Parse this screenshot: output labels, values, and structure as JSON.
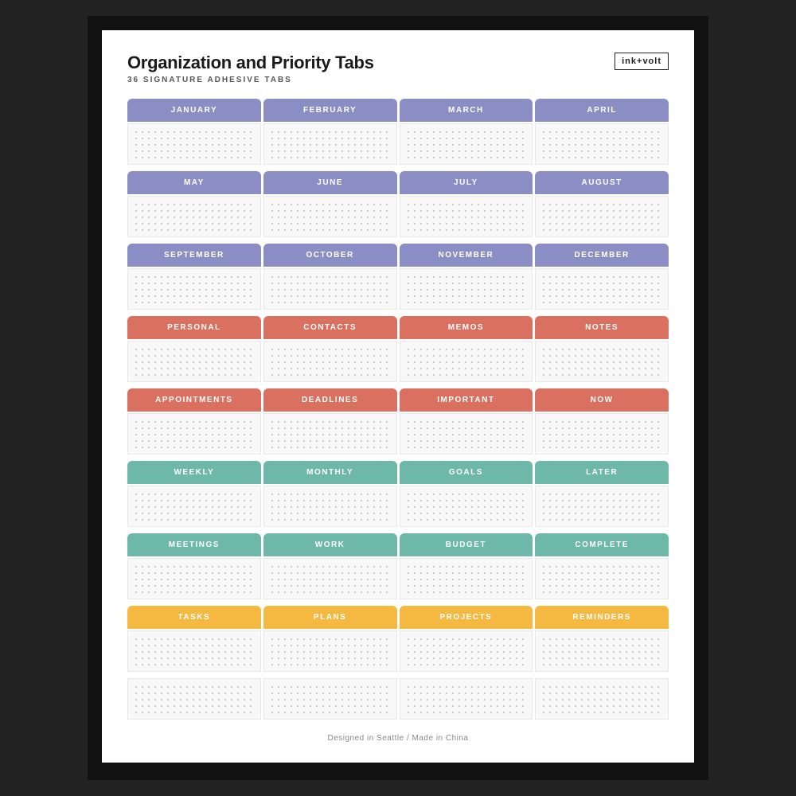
{
  "header": {
    "title": "Organization and Priority Tabs",
    "subtitle": "36 SIGNATURE ADHESIVE TABS",
    "brand": "ink+volt"
  },
  "rows": [
    {
      "color": "purple",
      "tabs": [
        "JANUARY",
        "FEBRUARY",
        "MARCH",
        "APRIL"
      ]
    },
    {
      "color": "purple",
      "tabs": [
        "MAY",
        "JUNE",
        "JULY",
        "AUGUST"
      ]
    },
    {
      "color": "purple",
      "tabs": [
        "SEPTEMBER",
        "OCTOBER",
        "NOVEMBER",
        "DECEMBER"
      ]
    },
    {
      "color": "salmon",
      "tabs": [
        "PERSONAL",
        "CONTACTS",
        "MEMOS",
        "NOTES"
      ]
    },
    {
      "color": "salmon",
      "tabs": [
        "APPOINTMENTS",
        "DEADLINES",
        "IMPORTANT",
        "NOW"
      ]
    },
    {
      "color": "teal",
      "tabs": [
        "WEEKLY",
        "MONTHLY",
        "GOALS",
        "LATER"
      ]
    },
    {
      "color": "teal",
      "tabs": [
        "MEETINGS",
        "WORK",
        "BUDGET",
        "COMPLETE"
      ]
    },
    {
      "color": "yellow",
      "tabs": [
        "TASKS",
        "PLANS",
        "PROJECTS",
        "REMINDERS"
      ]
    }
  ],
  "footer": "Designed in Seattle / Made in China"
}
